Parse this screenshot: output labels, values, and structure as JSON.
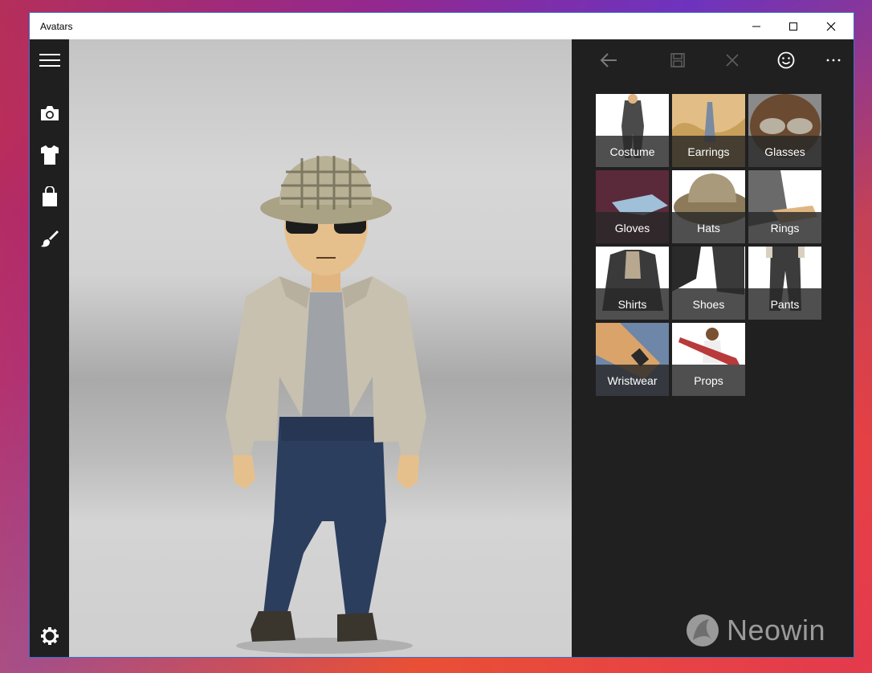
{
  "window": {
    "title": "Avatars",
    "controls": {
      "minimize": "minimize-icon",
      "maximize": "maximize-icon",
      "close": "close-icon"
    }
  },
  "nav_rail": {
    "items": [
      {
        "name": "menu",
        "icon": "hamburger-icon"
      },
      {
        "name": "camera",
        "icon": "camera-icon"
      },
      {
        "name": "wardrobe",
        "icon": "shirt-icon"
      },
      {
        "name": "store",
        "icon": "shopping-bag-icon"
      },
      {
        "name": "style",
        "icon": "paintbrush-icon"
      }
    ],
    "footer": {
      "name": "settings",
      "icon": "gear-icon"
    }
  },
  "command_bar": {
    "back": "back-arrow-icon",
    "save": "save-icon",
    "cancel": "close-icon",
    "emote": "smiley-icon",
    "more": "more-icon"
  },
  "categories": [
    {
      "label": "Costume",
      "art": "#4a4a4a"
    },
    {
      "label": "Earrings",
      "art": "#c9a05a"
    },
    {
      "label": "Glasses",
      "art": "#6a4a30"
    },
    {
      "label": "Gloves",
      "art": "#5a2a3a"
    },
    {
      "label": "Hats",
      "art": "#8c7a5a"
    },
    {
      "label": "Rings",
      "art": "#6a6a6a"
    },
    {
      "label": "Shirts",
      "art": "#3a3a3a"
    },
    {
      "label": "Shoes",
      "art": "#2a2a2a"
    },
    {
      "label": "Pants",
      "art": "#3c3c3c"
    },
    {
      "label": "Wristwear",
      "art": "#d9a36a"
    },
    {
      "label": "Props",
      "art": "#b83a3a"
    }
  ],
  "watermark": {
    "text": "Neowin"
  },
  "colors": {
    "panel_bg": "#202020",
    "label_bg": "#282828",
    "stage_bg": "#cfcfcf"
  }
}
